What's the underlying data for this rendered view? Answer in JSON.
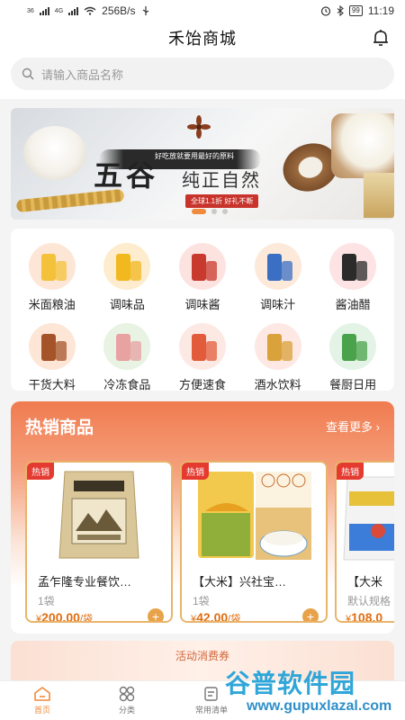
{
  "status_bar": {
    "signal1": "36",
    "signal2": "4G",
    "speed": "256B/s",
    "battery": "99",
    "time": "11:19"
  },
  "header": {
    "title": "禾饴商城",
    "bell_icon": "bell-icon"
  },
  "search": {
    "placeholder": "请输入商品名称",
    "icon": "search-icon"
  },
  "banner": {
    "subtitle": "好吃放就要用最好的原料",
    "title_big": "五谷",
    "title_small": "纯正自然",
    "tag": "全球1.1折 好礼不断",
    "slide_count": 3,
    "active_slide": 1
  },
  "categories": [
    {
      "label": "米面粮油",
      "colors": [
        "#fde6d6",
        "#f3c23a"
      ]
    },
    {
      "label": "调味品",
      "colors": [
        "#fdeccd",
        "#f2b81f"
      ]
    },
    {
      "label": "调味酱",
      "colors": [
        "#fde3e0",
        "#c83a2e"
      ]
    },
    {
      "label": "调味汁",
      "colors": [
        "#fde9da",
        "#3a6fc4"
      ]
    },
    {
      "label": "酱油醋",
      "colors": [
        "#fde3e3",
        "#2b2b2b"
      ]
    },
    {
      "label": "干货大料",
      "colors": [
        "#fde6d6",
        "#a5542a"
      ]
    },
    {
      "label": "冷冻食品",
      "colors": [
        "#e8f3e3",
        "#e8a2a2"
      ]
    },
    {
      "label": "方便速食",
      "colors": [
        "#fde9e4",
        "#e25b3b"
      ]
    },
    {
      "label": "酒水饮料",
      "colors": [
        "#fde8e3",
        "#d9a23a"
      ]
    },
    {
      "label": "餐厨日用",
      "colors": [
        "#e3f3e6",
        "#4aa34a"
      ]
    }
  ],
  "hot": {
    "title": "热销商品",
    "more": "查看更多",
    "badge": "热销",
    "products": [
      {
        "name": "孟乍隆专业餐饮…",
        "unit": "1袋",
        "currency": "¥",
        "price": "200.00",
        "per": "/袋"
      },
      {
        "name": "【大米】兴社宝…",
        "unit": "1袋",
        "currency": "¥",
        "price": "42.00",
        "per": "/袋"
      },
      {
        "name": "【大米",
        "unit": "默认规格",
        "currency": "¥",
        "price": "108.0",
        "per": ""
      }
    ]
  },
  "coupon": {
    "label": "活动消费券"
  },
  "tabbar": [
    {
      "label": "首页",
      "icon": "home-icon",
      "active": true
    },
    {
      "label": "分类",
      "icon": "category-icon",
      "active": false
    },
    {
      "label": "常用清单",
      "icon": "list-icon",
      "active": false
    }
  ],
  "watermark": {
    "title": "谷普软件园",
    "url": "www.gupuxlazal.com"
  },
  "colors": {
    "accent": "#f08a3c",
    "price": "#e06d10",
    "hot_badge": "#e43a30"
  }
}
